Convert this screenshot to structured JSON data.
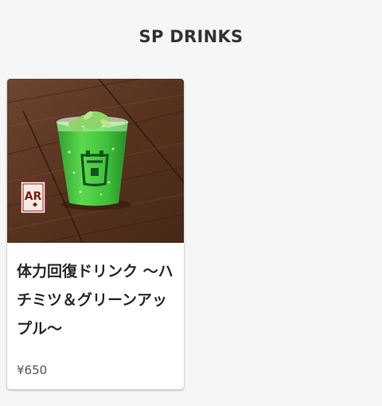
{
  "section": {
    "title": "SP DRINKS"
  },
  "products": [
    {
      "name": "体力回復ドリンク 〜ハチミツ＆グリーンアップル〜",
      "price": "¥650",
      "badge_text": "AR"
    }
  ],
  "colors": {
    "background": "#f5f7f7",
    "card": "#ffffff",
    "title_text": "#333333",
    "wood": "#5a3522",
    "drink_green": "#3fc23a",
    "badge_red": "#7a1d18"
  }
}
